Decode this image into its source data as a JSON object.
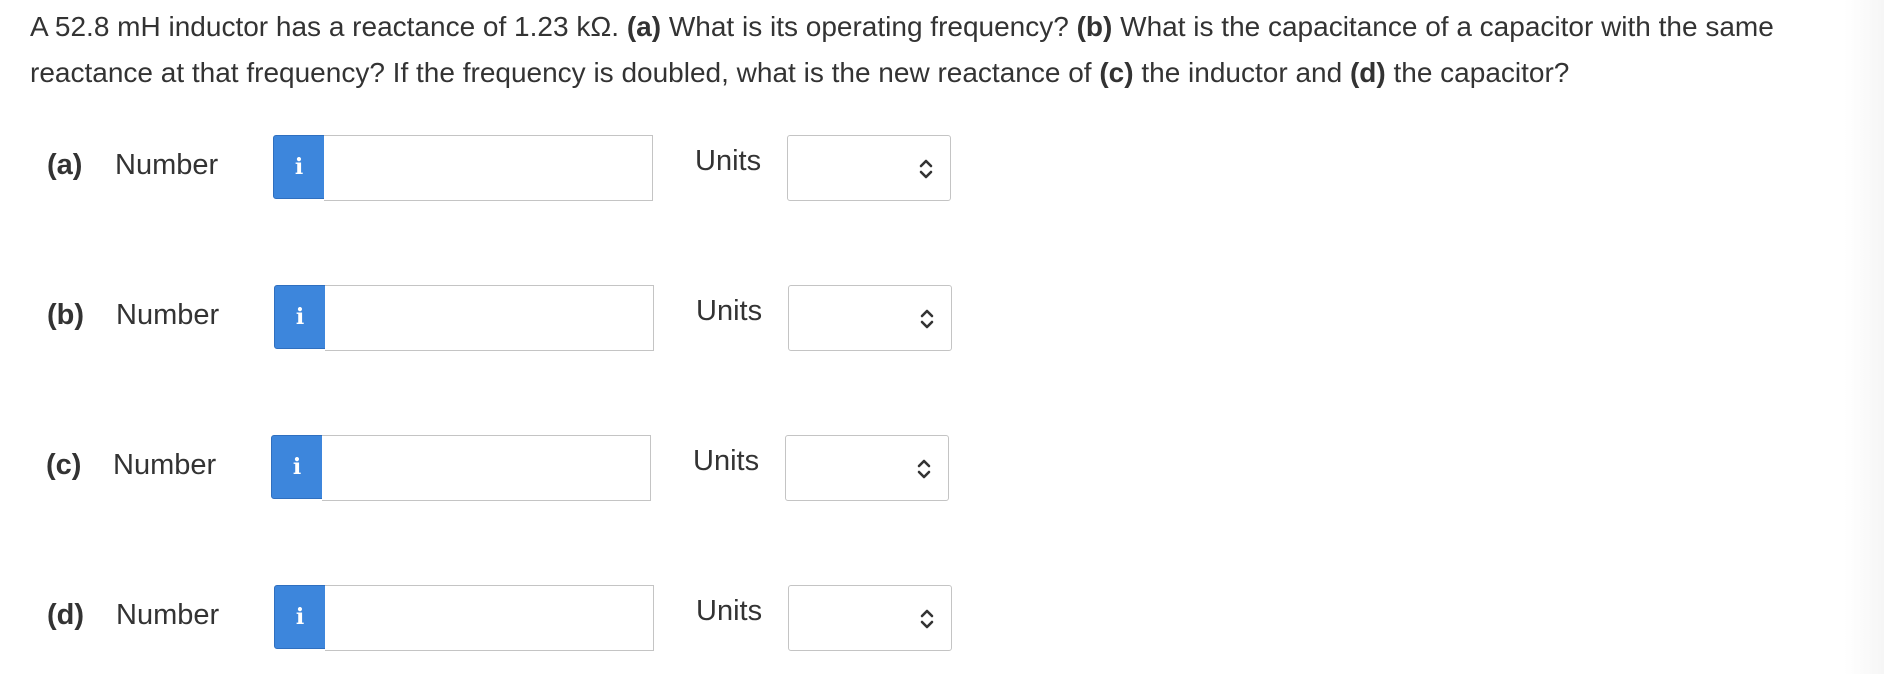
{
  "question": {
    "segments": [
      {
        "text": "A 52.8 mH inductor has a reactance of 1.23 kΩ. ",
        "bold": false
      },
      {
        "text": "(a)",
        "bold": true
      },
      {
        "text": " What is its operating frequency? ",
        "bold": false
      },
      {
        "text": "(b)",
        "bold": true
      },
      {
        "text": " What is the capacitance of a capacitor with the same reactance at that frequency? If the frequency is doubled, what is the new reactance of ",
        "bold": false
      },
      {
        "text": "(c)",
        "bold": true
      },
      {
        "text": " the inductor and ",
        "bold": false
      },
      {
        "text": "(d)",
        "bold": true
      },
      {
        "text": " the capacitor?",
        "bold": false
      }
    ]
  },
  "info_glyph": "i",
  "parts": [
    {
      "label": "(a)",
      "number_label": "Number",
      "value": "",
      "units_label": "Units",
      "units_value": ""
    },
    {
      "label": "(b)",
      "number_label": "Number",
      "value": "",
      "units_label": "Units",
      "units_value": ""
    },
    {
      "label": "(c)",
      "number_label": "Number",
      "value": "",
      "units_label": "Units",
      "units_value": ""
    },
    {
      "label": "(d)",
      "number_label": "Number",
      "value": "",
      "units_label": "Units",
      "units_value": ""
    }
  ],
  "colors": {
    "info_button": "#3d86dc",
    "text": "#333333",
    "border": "#c4c4c4"
  },
  "icons": {
    "info": "info-icon",
    "select": "chevron-up-down-icon"
  }
}
